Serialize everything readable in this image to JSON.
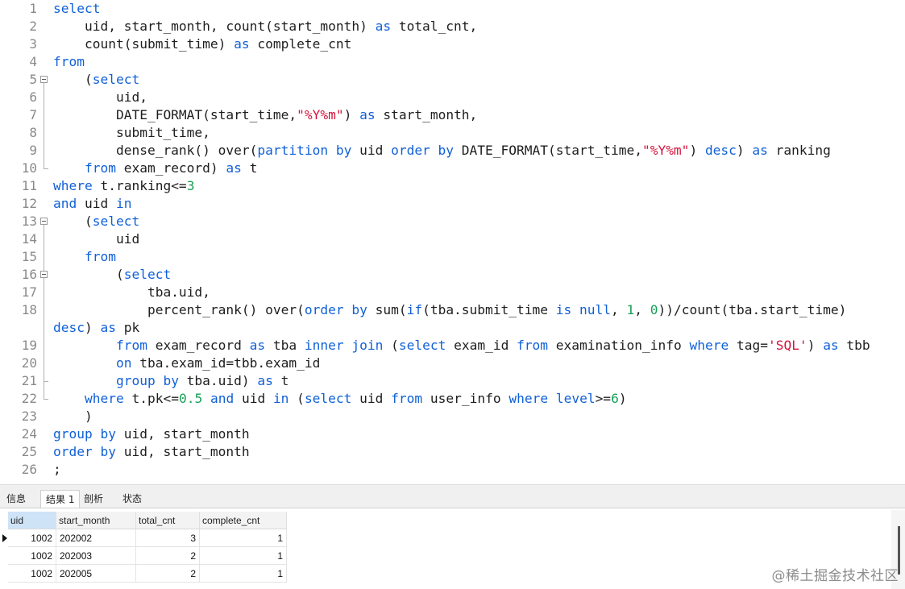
{
  "editor": {
    "lines": [
      {
        "n": "1",
        "t": [
          {
            "s": "select",
            "c": "kw"
          }
        ]
      },
      {
        "n": "2",
        "t": [
          {
            "s": "    uid, start_month, count(start_month) ",
            "c": "id"
          },
          {
            "s": "as",
            "c": "kw"
          },
          {
            "s": " total_cnt,",
            "c": "id"
          }
        ]
      },
      {
        "n": "3",
        "t": [
          {
            "s": "    count(submit_time) ",
            "c": "id"
          },
          {
            "s": "as",
            "c": "kw"
          },
          {
            "s": " complete_cnt",
            "c": "id"
          }
        ]
      },
      {
        "n": "4",
        "t": [
          {
            "s": "from",
            "c": "kw"
          }
        ]
      },
      {
        "n": "5",
        "t": [
          {
            "s": "    (",
            "c": "id"
          },
          {
            "s": "select",
            "c": "kw"
          }
        ]
      },
      {
        "n": "6",
        "t": [
          {
            "s": "        uid,",
            "c": "id"
          }
        ]
      },
      {
        "n": "7",
        "t": [
          {
            "s": "        DATE_FORMAT(start_time,",
            "c": "id"
          },
          {
            "s": "\"%Y%m\"",
            "c": "str"
          },
          {
            "s": ") ",
            "c": "id"
          },
          {
            "s": "as",
            "c": "kw"
          },
          {
            "s": " start_month,",
            "c": "id"
          }
        ]
      },
      {
        "n": "8",
        "t": [
          {
            "s": "        submit_time,",
            "c": "id"
          }
        ]
      },
      {
        "n": "9",
        "t": [
          {
            "s": "        dense_rank() over(",
            "c": "id"
          },
          {
            "s": "partition by",
            "c": "kw"
          },
          {
            "s": " uid ",
            "c": "id"
          },
          {
            "s": "order by",
            "c": "kw"
          },
          {
            "s": " DATE_FORMAT(start_time,",
            "c": "id"
          },
          {
            "s": "\"%Y%m\"",
            "c": "str"
          },
          {
            "s": ") ",
            "c": "id"
          },
          {
            "s": "desc",
            "c": "kw"
          },
          {
            "s": ") ",
            "c": "id"
          },
          {
            "s": "as",
            "c": "kw"
          },
          {
            "s": " ranking",
            "c": "id"
          }
        ]
      },
      {
        "n": "10",
        "t": [
          {
            "s": "    ",
            "c": "id"
          },
          {
            "s": "from",
            "c": "kw"
          },
          {
            "s": " exam_record) ",
            "c": "id"
          },
          {
            "s": "as",
            "c": "kw"
          },
          {
            "s": " t",
            "c": "id"
          }
        ]
      },
      {
        "n": "11",
        "t": [
          {
            "s": "where",
            "c": "kw"
          },
          {
            "s": " t.ranking<=",
            "c": "id"
          },
          {
            "s": "3",
            "c": "num"
          }
        ]
      },
      {
        "n": "12",
        "t": [
          {
            "s": "and",
            "c": "kw"
          },
          {
            "s": " uid ",
            "c": "id"
          },
          {
            "s": "in",
            "c": "kw"
          }
        ]
      },
      {
        "n": "13",
        "t": [
          {
            "s": "    (",
            "c": "id"
          },
          {
            "s": "select",
            "c": "kw"
          }
        ]
      },
      {
        "n": "14",
        "t": [
          {
            "s": "        uid",
            "c": "id"
          }
        ]
      },
      {
        "n": "15",
        "t": [
          {
            "s": "    ",
            "c": "id"
          },
          {
            "s": "from",
            "c": "kw"
          }
        ]
      },
      {
        "n": "16",
        "t": [
          {
            "s": "        (",
            "c": "id"
          },
          {
            "s": "select",
            "c": "kw"
          }
        ]
      },
      {
        "n": "17",
        "t": [
          {
            "s": "            tba.uid,",
            "c": "id"
          }
        ]
      },
      {
        "n": "18",
        "t": [
          {
            "s": "            percent_rank() over(",
            "c": "id"
          },
          {
            "s": "order by",
            "c": "kw"
          },
          {
            "s": " sum(",
            "c": "id"
          },
          {
            "s": "if",
            "c": "kw"
          },
          {
            "s": "(tba.submit_time ",
            "c": "id"
          },
          {
            "s": "is null",
            "c": "kw"
          },
          {
            "s": ", ",
            "c": "id"
          },
          {
            "s": "1",
            "c": "num"
          },
          {
            "s": ", ",
            "c": "id"
          },
          {
            "s": "0",
            "c": "num"
          },
          {
            "s": "))/count(tba.start_time)",
            "c": "id"
          }
        ]
      },
      {
        "n": "",
        "t": [
          {
            "s": "desc",
            "c": "kw"
          },
          {
            "s": ") ",
            "c": "id"
          },
          {
            "s": "as",
            "c": "kw"
          },
          {
            "s": " pk",
            "c": "id"
          }
        ]
      },
      {
        "n": "19",
        "t": [
          {
            "s": "        ",
            "c": "id"
          },
          {
            "s": "from",
            "c": "kw"
          },
          {
            "s": " exam_record ",
            "c": "id"
          },
          {
            "s": "as",
            "c": "kw"
          },
          {
            "s": " tba ",
            "c": "id"
          },
          {
            "s": "inner join",
            "c": "kw"
          },
          {
            "s": " (",
            "c": "id"
          },
          {
            "s": "select",
            "c": "kw"
          },
          {
            "s": " exam_id ",
            "c": "id"
          },
          {
            "s": "from",
            "c": "kw"
          },
          {
            "s": " examination_info ",
            "c": "id"
          },
          {
            "s": "where",
            "c": "kw"
          },
          {
            "s": " tag=",
            "c": "id"
          },
          {
            "s": "'SQL'",
            "c": "str"
          },
          {
            "s": ") ",
            "c": "id"
          },
          {
            "s": "as",
            "c": "kw"
          },
          {
            "s": " tbb",
            "c": "id"
          }
        ]
      },
      {
        "n": "20",
        "t": [
          {
            "s": "        ",
            "c": "id"
          },
          {
            "s": "on",
            "c": "kw"
          },
          {
            "s": " tba.exam_id=tbb.exam_id",
            "c": "id"
          }
        ]
      },
      {
        "n": "21",
        "t": [
          {
            "s": "        ",
            "c": "id"
          },
          {
            "s": "group by",
            "c": "kw"
          },
          {
            "s": " tba.uid) ",
            "c": "id"
          },
          {
            "s": "as",
            "c": "kw"
          },
          {
            "s": " t",
            "c": "id"
          }
        ]
      },
      {
        "n": "22",
        "t": [
          {
            "s": "    ",
            "c": "id"
          },
          {
            "s": "where",
            "c": "kw"
          },
          {
            "s": " t.pk<=",
            "c": "id"
          },
          {
            "s": "0.5",
            "c": "num"
          },
          {
            "s": " ",
            "c": "id"
          },
          {
            "s": "and",
            "c": "kw"
          },
          {
            "s": " uid ",
            "c": "id"
          },
          {
            "s": "in",
            "c": "kw"
          },
          {
            "s": " (",
            "c": "id"
          },
          {
            "s": "select",
            "c": "kw"
          },
          {
            "s": " uid ",
            "c": "id"
          },
          {
            "s": "from",
            "c": "kw"
          },
          {
            "s": " user_info ",
            "c": "id"
          },
          {
            "s": "where",
            "c": "kw"
          },
          {
            "s": " ",
            "c": "id"
          },
          {
            "s": "level",
            "c": "kw"
          },
          {
            "s": ">=",
            "c": "id"
          },
          {
            "s": "6",
            "c": "num"
          },
          {
            "s": ")",
            "c": "id"
          }
        ]
      },
      {
        "n": "23",
        "t": [
          {
            "s": "    )",
            "c": "id"
          }
        ]
      },
      {
        "n": "24",
        "t": [
          {
            "s": "group by",
            "c": "kw"
          },
          {
            "s": " uid, start_month",
            "c": "id"
          }
        ]
      },
      {
        "n": "25",
        "t": [
          {
            "s": "order by",
            "c": "kw"
          },
          {
            "s": " uid, start_month",
            "c": "id"
          }
        ]
      },
      {
        "n": "26",
        "t": [
          {
            "s": ";",
            "c": "id"
          }
        ]
      }
    ],
    "colors": {
      "keyword": "#1060d8",
      "string": "#d4143c",
      "number": "#18a058",
      "text": "#1e1e1e"
    }
  },
  "tabs": [
    {
      "label": "信息",
      "active": false
    },
    {
      "label": "结果 1",
      "active": true
    },
    {
      "label": "剖析",
      "active": false
    },
    {
      "label": "状态",
      "active": false
    }
  ],
  "results": {
    "columns": [
      "uid",
      "start_month",
      "total_cnt",
      "complete_cnt"
    ],
    "rows": [
      [
        "1002",
        "202002",
        "3",
        "1"
      ],
      [
        "1002",
        "202003",
        "2",
        "1"
      ],
      [
        "1002",
        "202005",
        "2",
        "1"
      ]
    ]
  },
  "watermark": "@稀土掘金技术社区"
}
